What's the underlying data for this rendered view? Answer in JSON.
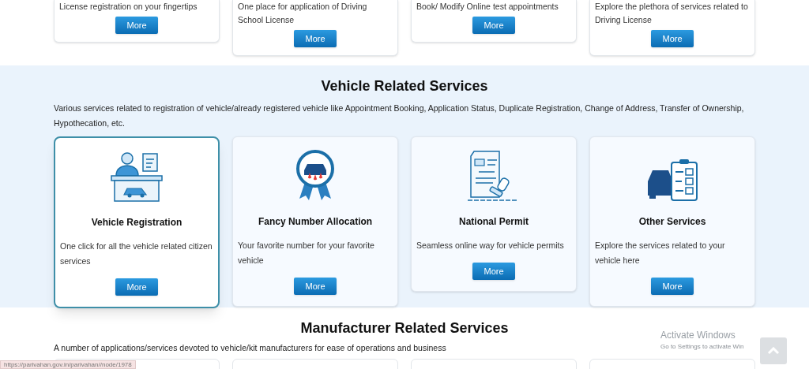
{
  "top_cards": [
    {
      "description": "License registration on your fingertips",
      "button": "More"
    },
    {
      "description": "One place for application of Driving School License",
      "button": "More"
    },
    {
      "description": "Book/ Modify Online test appointments",
      "button": "More"
    },
    {
      "description": "Explore the plethora of services related to Driving License",
      "button": "More"
    }
  ],
  "vehicle_section": {
    "title": "Vehicle Related Services",
    "description": "Various services related to registration of vehicle/already registered vehicle like Appointment Booking, Application Status, Duplicate Registration, Change of Address, Transfer of Ownership, Hypothecation, etc.",
    "cards": [
      {
        "kind": "registration",
        "title": "Vehicle Registration",
        "description": "One click for all the vehicle related citizen services",
        "button": "More",
        "highlighted": true
      },
      {
        "kind": "fancy_number",
        "title": "Fancy Number Allocation",
        "description": "Your favorite number for your favorite vehicle",
        "button": "More",
        "highlighted": false
      },
      {
        "kind": "permit",
        "title": "National Permit",
        "description": "Seamless online way for vehicle permits",
        "button": "More",
        "highlighted": false
      },
      {
        "kind": "other",
        "title": "Other Services",
        "description": "Explore the services related to your vehicle here",
        "button": "More",
        "highlighted": false
      }
    ]
  },
  "manufacturer_section": {
    "title": "Manufacturer Related Services",
    "description": "A number of applications/services devoted to vehicle/kit manufacturers for ease of operations and business"
  },
  "status_url": "https://parivahan.gov.in/parivahan//node/1978",
  "os_notice": {
    "title": "Activate Windows",
    "subtitle": "Go to Settings to activate Win"
  }
}
